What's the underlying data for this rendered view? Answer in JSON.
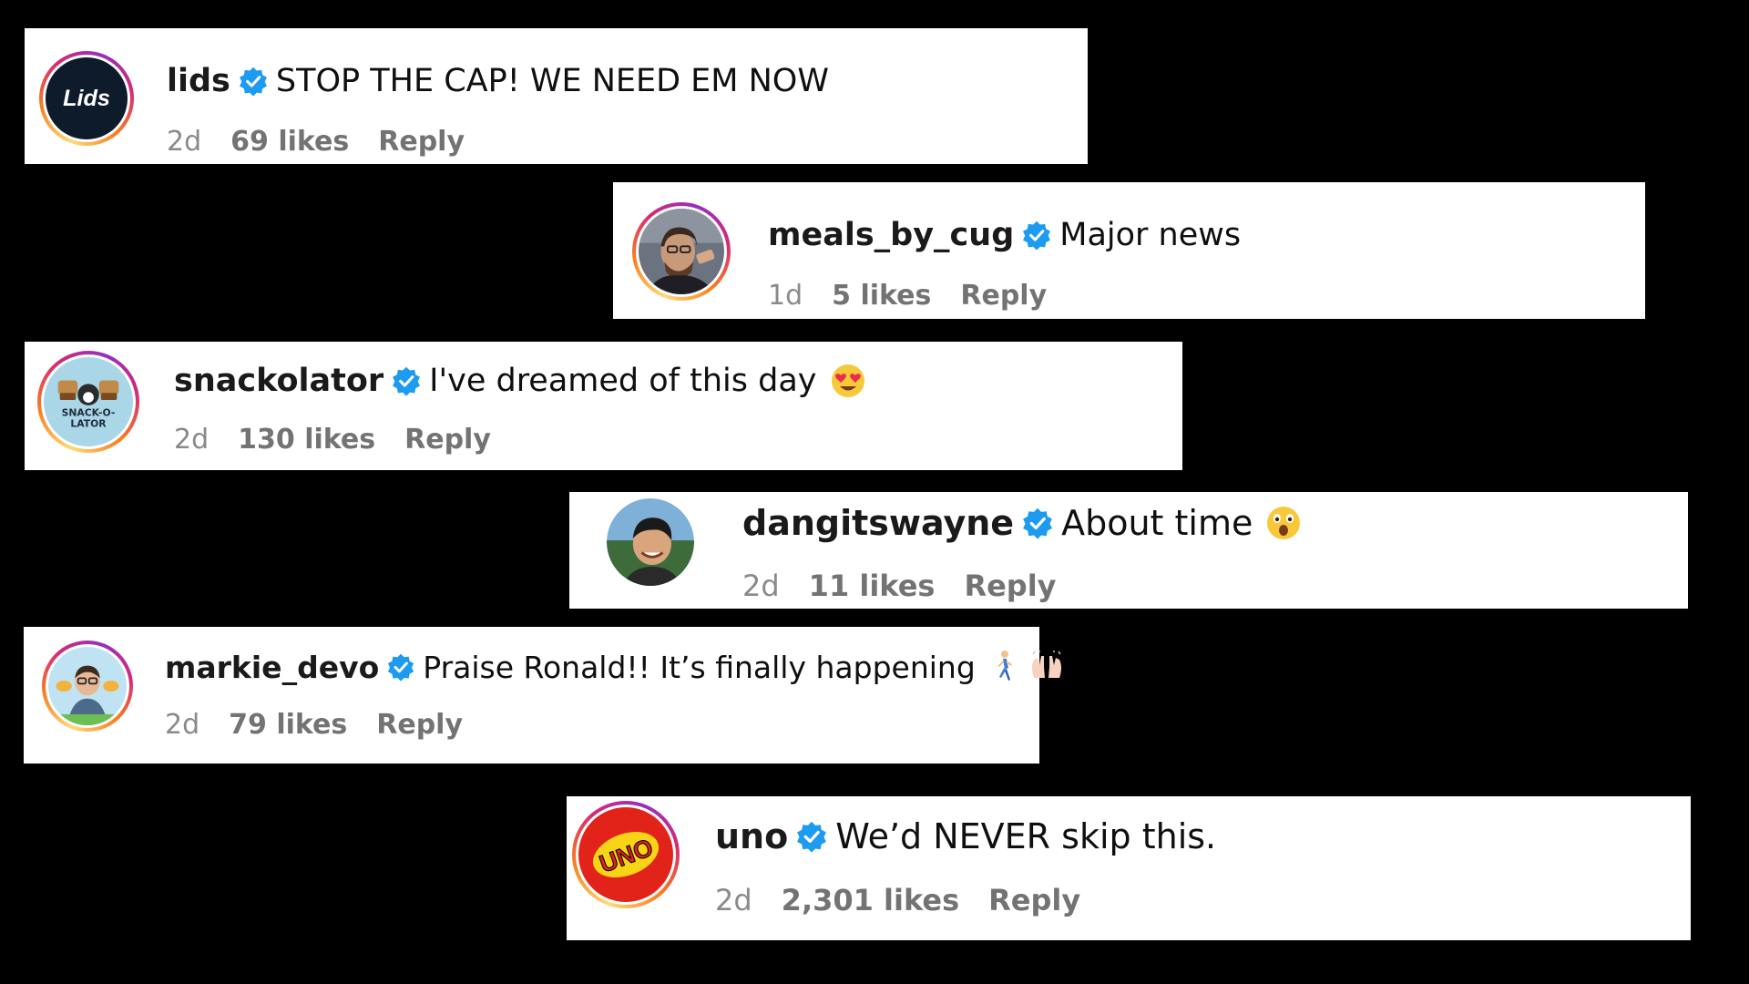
{
  "comments": [
    {
      "username": "lids",
      "text": "STOP THE CAP! WE NEED EM NOW",
      "time": "2d",
      "likes": "69 likes",
      "reply": "Reply",
      "avatar_text": "Lids"
    },
    {
      "username": "meals_by_cug",
      "text": "Major news",
      "time": "1d",
      "likes": "5 likes",
      "reply": "Reply"
    },
    {
      "username": "snackolator",
      "text": "I've dreamed of this day",
      "time": "2d",
      "likes": "130 likes",
      "reply": "Reply",
      "avatar_text": "SNACK-O-LATOR",
      "emoji": "heart-eyes-emoji"
    },
    {
      "username": "dangitswayne",
      "text": "About time",
      "time": "2d",
      "likes": "11 likes",
      "reply": "Reply",
      "emoji": "astonished-face-emoji"
    },
    {
      "username": "markie_devo",
      "text": "Praise Ronald!! It’s finally happening",
      "time": "2d",
      "likes": "79 likes",
      "reply": "Reply",
      "emoji": [
        "person-walking-emoji",
        "raising-hands-emoji"
      ]
    },
    {
      "username": "uno",
      "text": "We’d NEVER skip this.",
      "time": "2d",
      "likes": "2,301 likes",
      "reply": "Reply",
      "avatar_text": "UNO"
    }
  ],
  "colors": {
    "background": "#000000",
    "card": "#ffffff",
    "verified_badge": "#1d9bf0",
    "meta_text": "#737373"
  }
}
